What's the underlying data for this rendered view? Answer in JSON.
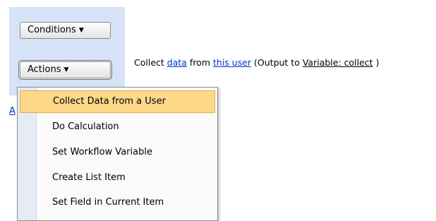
{
  "buttons": {
    "conditions_label": "Conditions",
    "actions_label": "Actions",
    "arrow_glyph": "▼"
  },
  "step": {
    "prefix": "Collect",
    "data_link": "data",
    "from_text": "from",
    "user_link": "this user",
    "output_open": "(Output to",
    "variable_link": "Variable: collect",
    "output_close": ")"
  },
  "peek_link": "A",
  "menu": {
    "items": [
      {
        "label": "Collect Data from a User",
        "selected": true
      },
      {
        "label": "Do Calculation",
        "selected": false
      },
      {
        "label": "Set Workflow Variable",
        "selected": false
      },
      {
        "label": "Create List Item",
        "selected": false
      },
      {
        "label": "Set Field in Current Item",
        "selected": false
      }
    ]
  },
  "colors": {
    "strip": "#d6e3f7",
    "menu_highlight": "#fdd889",
    "link": "#0033cc"
  }
}
